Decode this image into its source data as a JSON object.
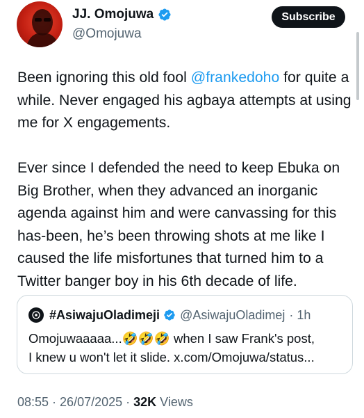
{
  "author": {
    "display_name": "JJ. Omojuwa",
    "handle": "@Omojuwa",
    "verified": true
  },
  "subscribe_label": "Subscribe",
  "tweet": {
    "p1_before": "Been ignoring this old fool ",
    "p1_mention": "@frankedoho",
    "p1_after": " for quite a while. Never engaged his agbaya attempts at using me for X engagements.",
    "p2": "Ever since I defended the need to keep Ebuka on Big Brother, when they advanced an inorganic agenda against him and were canvassing for this has-been, he’s been throwing shots at me like I caused the life misfortunes that turned him to a Twitter banger boy in his 6th decade of life."
  },
  "quote": {
    "name": "#AsiwajuOladimeji",
    "handle": "@AsiwajuOladimej",
    "time": "· 1h",
    "line1_before": "Omojuwaaaaa...",
    "emojis": "🤣🤣🤣",
    "line1_after": " when I saw Frank's post,",
    "line2": "I knew u won't let it slide. x.com/Omojuwa/status..."
  },
  "footer": {
    "time": "08:55",
    "sep1": " · ",
    "date": "26/07/2025",
    "sep2": " · ",
    "views_count": "32K",
    "views_label": " Views"
  },
  "colors": {
    "text": "#0f1419",
    "secondary": "#536471",
    "link": "#1d9bf0",
    "verified": "#1d9bf0",
    "border": "#cfd9de"
  }
}
